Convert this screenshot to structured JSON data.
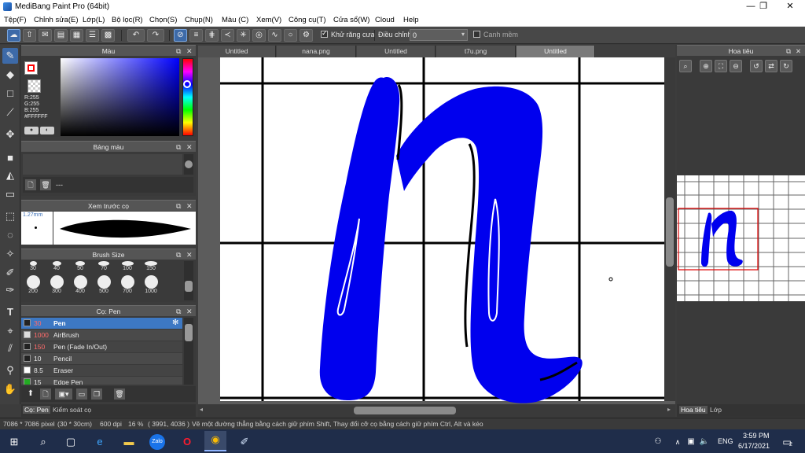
{
  "window": {
    "title": "MediBang Paint Pro (64bit)",
    "minimize": "—",
    "maximize": "❐",
    "close": "✕"
  },
  "menu": [
    "Tệp(F)",
    "Chỉnh sửa(E)",
    "Lớp(L)",
    "Bộ lọc(R)",
    "Chọn(S)",
    "Chụp(N)",
    "Màu (C)",
    "Xem(V)",
    "Công cụ(T)",
    "Cửa sổ(W)",
    "Cloud",
    "Help"
  ],
  "toolbar": {
    "antialias_label": "Khử răng cưa",
    "antialias_checked": true,
    "correction_label": "Điều chỉnh",
    "correction_value": "0",
    "snap_label": "Canh mềm",
    "snap_checked": false
  },
  "color_panel": {
    "title": "Màu",
    "r": "R:255",
    "g": "G:255",
    "b": "B:255",
    "hex": "#FFFFFF",
    "foreground": "#ff0000",
    "background": "#ffffff"
  },
  "palette_panel": {
    "title": "Bảng màu",
    "entry": "---"
  },
  "brush_preview_panel": {
    "title": "Xem trước cọ",
    "size": "1.27mm"
  },
  "brush_size_panel": {
    "title": "Brush Size",
    "row1": [
      "30",
      "40",
      "50",
      "70",
      "100",
      "150"
    ],
    "row2": [
      "200",
      "300",
      "400",
      "500",
      "700",
      "1000"
    ]
  },
  "brush_panel": {
    "title": "Cọ: Pen",
    "items": [
      {
        "size": "30",
        "name": "Pen",
        "color": "#222222",
        "selected": true
      },
      {
        "size": "1000",
        "name": "AirBrush",
        "color": "#dddddd",
        "selected": false
      },
      {
        "size": "150",
        "name": "Pen (Fade In/Out)",
        "color": "#222222",
        "selected": false
      },
      {
        "size": "10",
        "name": "Pencil",
        "color": "#222222",
        "selected": false
      },
      {
        "size": "8.5",
        "name": "Eraser",
        "color": "#ffffff",
        "selected": false
      },
      {
        "size": "15",
        "name": "Edge Pen",
        "color": "#22aa22",
        "selected": false
      }
    ]
  },
  "bottom_tabs": {
    "pen": "Cọ: Pen",
    "control": "Kiểm soát cọ"
  },
  "tabs": [
    "Untitled",
    "nana.png",
    "Untitled",
    "t7u.png",
    "Untitled"
  ],
  "active_tab": 4,
  "navigator": {
    "title": "Hoa tiêu",
    "tab_nav": "Hoa tiêu",
    "tab_layer": "Lớp"
  },
  "status": {
    "size": "7086 * 7086 pixel",
    "physical": "(30 * 30cm)",
    "dpi": "600 dpi",
    "zoom": "16 %",
    "coords": "( 3991, 4036 )",
    "hint": "Vẽ một đường thẳng bằng cách giữ phím Shift, Thay đổi cỡ cọ bằng cách giữ phím Ctrl, Alt và kéo"
  },
  "taskbar": {
    "time": "3:59 PM",
    "date": "6/17/2021",
    "lang": "ENG",
    "notif_count": "2"
  }
}
